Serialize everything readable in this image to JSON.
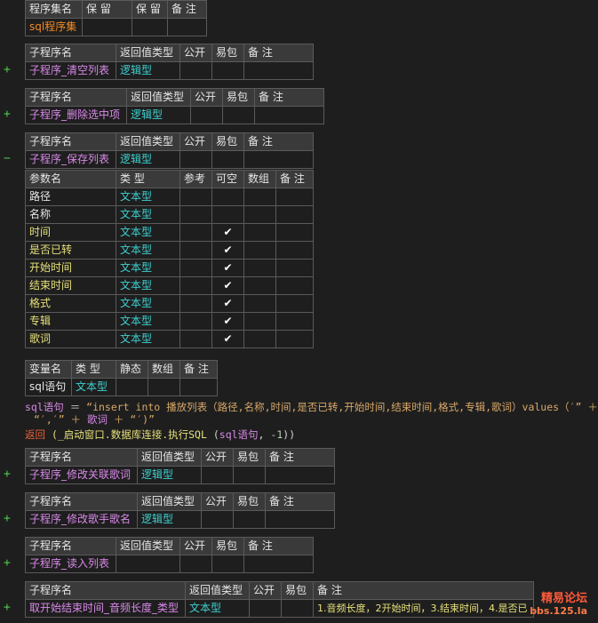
{
  "program_set": {
    "headers": [
      "程序集名",
      "保 留",
      "保 留",
      "备 注"
    ],
    "name": "sql程序集"
  },
  "subs": [
    {
      "sign": "+",
      "headers": [
        "子程序名",
        "返回值类型",
        "公开",
        "易包",
        "备 注"
      ],
      "name": "子程序_清空列表",
      "return_type": "逻辑型",
      "remark": ""
    },
    {
      "sign": "+",
      "headers": [
        "子程序名",
        "返回值类型",
        "公开",
        "易包",
        "备 注"
      ],
      "name": "子程序_删除选中项",
      "return_type": "逻辑型",
      "remark": ""
    },
    {
      "sign": "−",
      "headers": [
        "子程序名",
        "返回值类型",
        "公开",
        "易包",
        "备 注"
      ],
      "name": "子程序_保存列表",
      "return_type": "逻辑型",
      "remark": ""
    },
    {
      "sign": "+",
      "headers": [
        "子程序名",
        "返回值类型",
        "公开",
        "易包",
        "备 注"
      ],
      "name": "子程序_修改关联歌词",
      "return_type": "逻辑型",
      "remark": ""
    },
    {
      "sign": "+",
      "headers": [
        "子程序名",
        "返回值类型",
        "公开",
        "易包",
        "备 注"
      ],
      "name": "子程序_修改歌手歌名",
      "return_type": "逻辑型",
      "remark": ""
    },
    {
      "sign": "+",
      "headers": [
        "子程序名",
        "返回值类型",
        "公开",
        "易包",
        "备 注"
      ],
      "name": "子程序_读入列表",
      "return_type": "",
      "remark": ""
    },
    {
      "sign": "+",
      "headers": [
        "子程序名",
        "返回值类型",
        "公开",
        "易包",
        "备 注"
      ],
      "name": "取开始结束时间_音频长度_类型",
      "return_type": "文本型",
      "remark": "1.音频长度，2开始时间，3.结束时间，4.是否已"
    }
  ],
  "params": {
    "headers": [
      "参数名",
      "类 型",
      "参考",
      "可空",
      "数组",
      "备 注"
    ],
    "rows": [
      {
        "name": "路径",
        "type": "文本型",
        "nullable": ""
      },
      {
        "name": "名称",
        "type": "文本型",
        "nullable": ""
      },
      {
        "name": "时间",
        "type": "文本型",
        "nullable": "✔"
      },
      {
        "name": "是否已转",
        "type": "文本型",
        "nullable": "✔"
      },
      {
        "name": "开始时间",
        "type": "文本型",
        "nullable": "✔"
      },
      {
        "name": "结束时间",
        "type": "文本型",
        "nullable": "✔"
      },
      {
        "name": "格式",
        "type": "文本型",
        "nullable": "✔"
      },
      {
        "name": "专辑",
        "type": "文本型",
        "nullable": "✔"
      },
      {
        "name": "歌词",
        "type": "文本型",
        "nullable": "✔"
      }
    ]
  },
  "locals": {
    "headers": [
      "变量名",
      "类 型",
      "静态",
      "数组",
      "备 注"
    ],
    "name": "sql语句",
    "type": "文本型"
  },
  "code": {
    "line1_var": "sql语句",
    "line1_op": " ＝ ",
    "line1_str": "“insert into 播放列表（路径,名称,时间,是否已转,开始时间,结束时间,格式,专辑,歌词）values（′” ＋",
    "line2_str": "“′,′” ＋ ",
    "line2_var": "歌词",
    "line2_rest": " ＋ “′)”",
    "line3_kw": "返回",
    "line3_func": "(_启动窗口.数据库连接.执行SQL",
    "line3_args_open": " (",
    "line3_var": "sql语句",
    "line3_rest": ", ",
    "line3_num": "-1",
    "line3_close": "))"
  },
  "watermark": {
    "line1": "精易论坛",
    "line2": "bbs.125.la"
  }
}
